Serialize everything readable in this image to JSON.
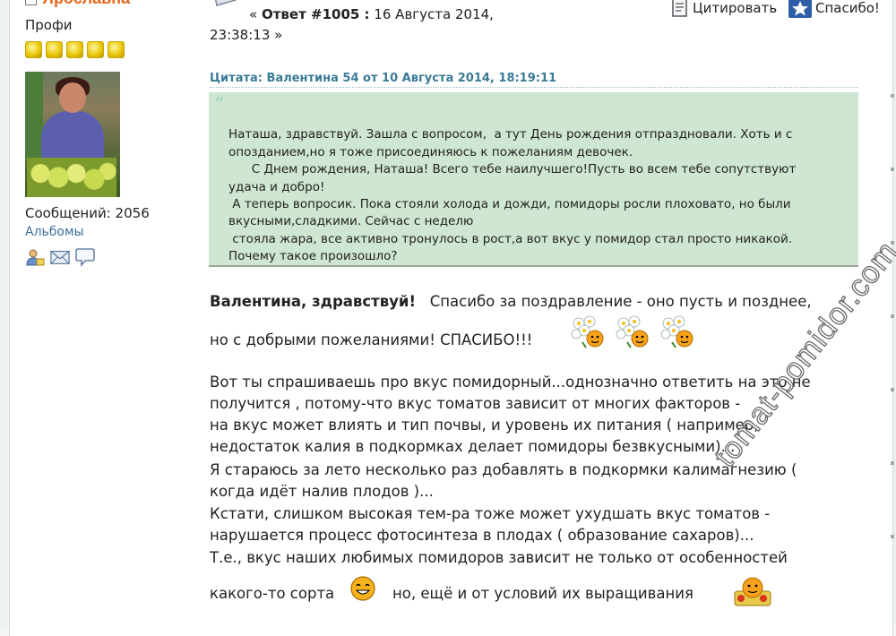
{
  "poster": {
    "name": "Ярославна",
    "rank": "Профи",
    "star_count": 5,
    "messages": "Сообщений: 2056",
    "albums_link": "Альбомы",
    "icons": [
      "profile-icon",
      "email-icon",
      "speech-bubble-icon"
    ]
  },
  "post": {
    "reply_prefix": "«",
    "reply_number": "Ответ #1005 :",
    "reply_date": "16 Августа 2014,",
    "reply_time": "23:38:13 »",
    "quote_button": "Цитировать",
    "thanks_button": "Спасибо!"
  },
  "quote": {
    "header": "Цитата: Валентина 54 от 10 Августа 2014, 18:19:11",
    "lines": [
      "Наташа, здравствуй. Зашла с вопросом,  а тут День рождения отпраздновали. Хоть и с",
      "опозданием,но я тоже присоединяюсь к пожеланиям девочек.",
      "      С Днем рождения, Наташа! Всего тебе наилучшего!Пусть во всем тебе сопутствуют",
      "удача и добро!",
      " А теперь вопросик. Пока стояли холода и дожди, помидоры росли плоховато, но были",
      "вкусными,сладкими. Сейчас с неделю",
      " стояла жара, все активно тронулось в рост,а вот вкус у помидор стал просто никакой.",
      "Почему такое произошло?"
    ]
  },
  "reply": {
    "greeting_bold": "Валентина, здравствуй!",
    "greeting_rest": "Спасибо за поздравление - оно пусть и позднее,",
    "line2": "но с добрыми пожеланиями!  СПАСИБО!!!",
    "paragraph": [
      "Вот ты спрашиваешь про вкус помидорный...однозначно ответить на это не",
      "получится , потому-что вкус томатов зависит от многих факторов -",
      "на вкус может влиять и тип почвы, и уровень их питания ( например,",
      "недостаток калия в подкормках делает помидоры безвкусными)...",
      "Я стараюсь за лето несколько раз добавлять в подкормки калимагнезию (",
      "когда идёт налив плодов )...",
      "Кстати, слишком высокая тем-ра тоже может ухудшать вкус томатов -",
      "нарушается процесс фотосинтеза в плодах ( образование сахаров)...",
      "Т.е., вкус наших любимых помидоров зависит не только от особенностей"
    ],
    "last_line_a": "какого-то сорта",
    "last_line_b": "но, ещё и от условий их выращивания"
  },
  "watermark": "tomat-pomidor.com",
  "colors": {
    "poster_name": "#e2661b",
    "quote_header": "#3a7b96",
    "quote_background": "#cfe6d3",
    "link": "#3c6e9a"
  }
}
